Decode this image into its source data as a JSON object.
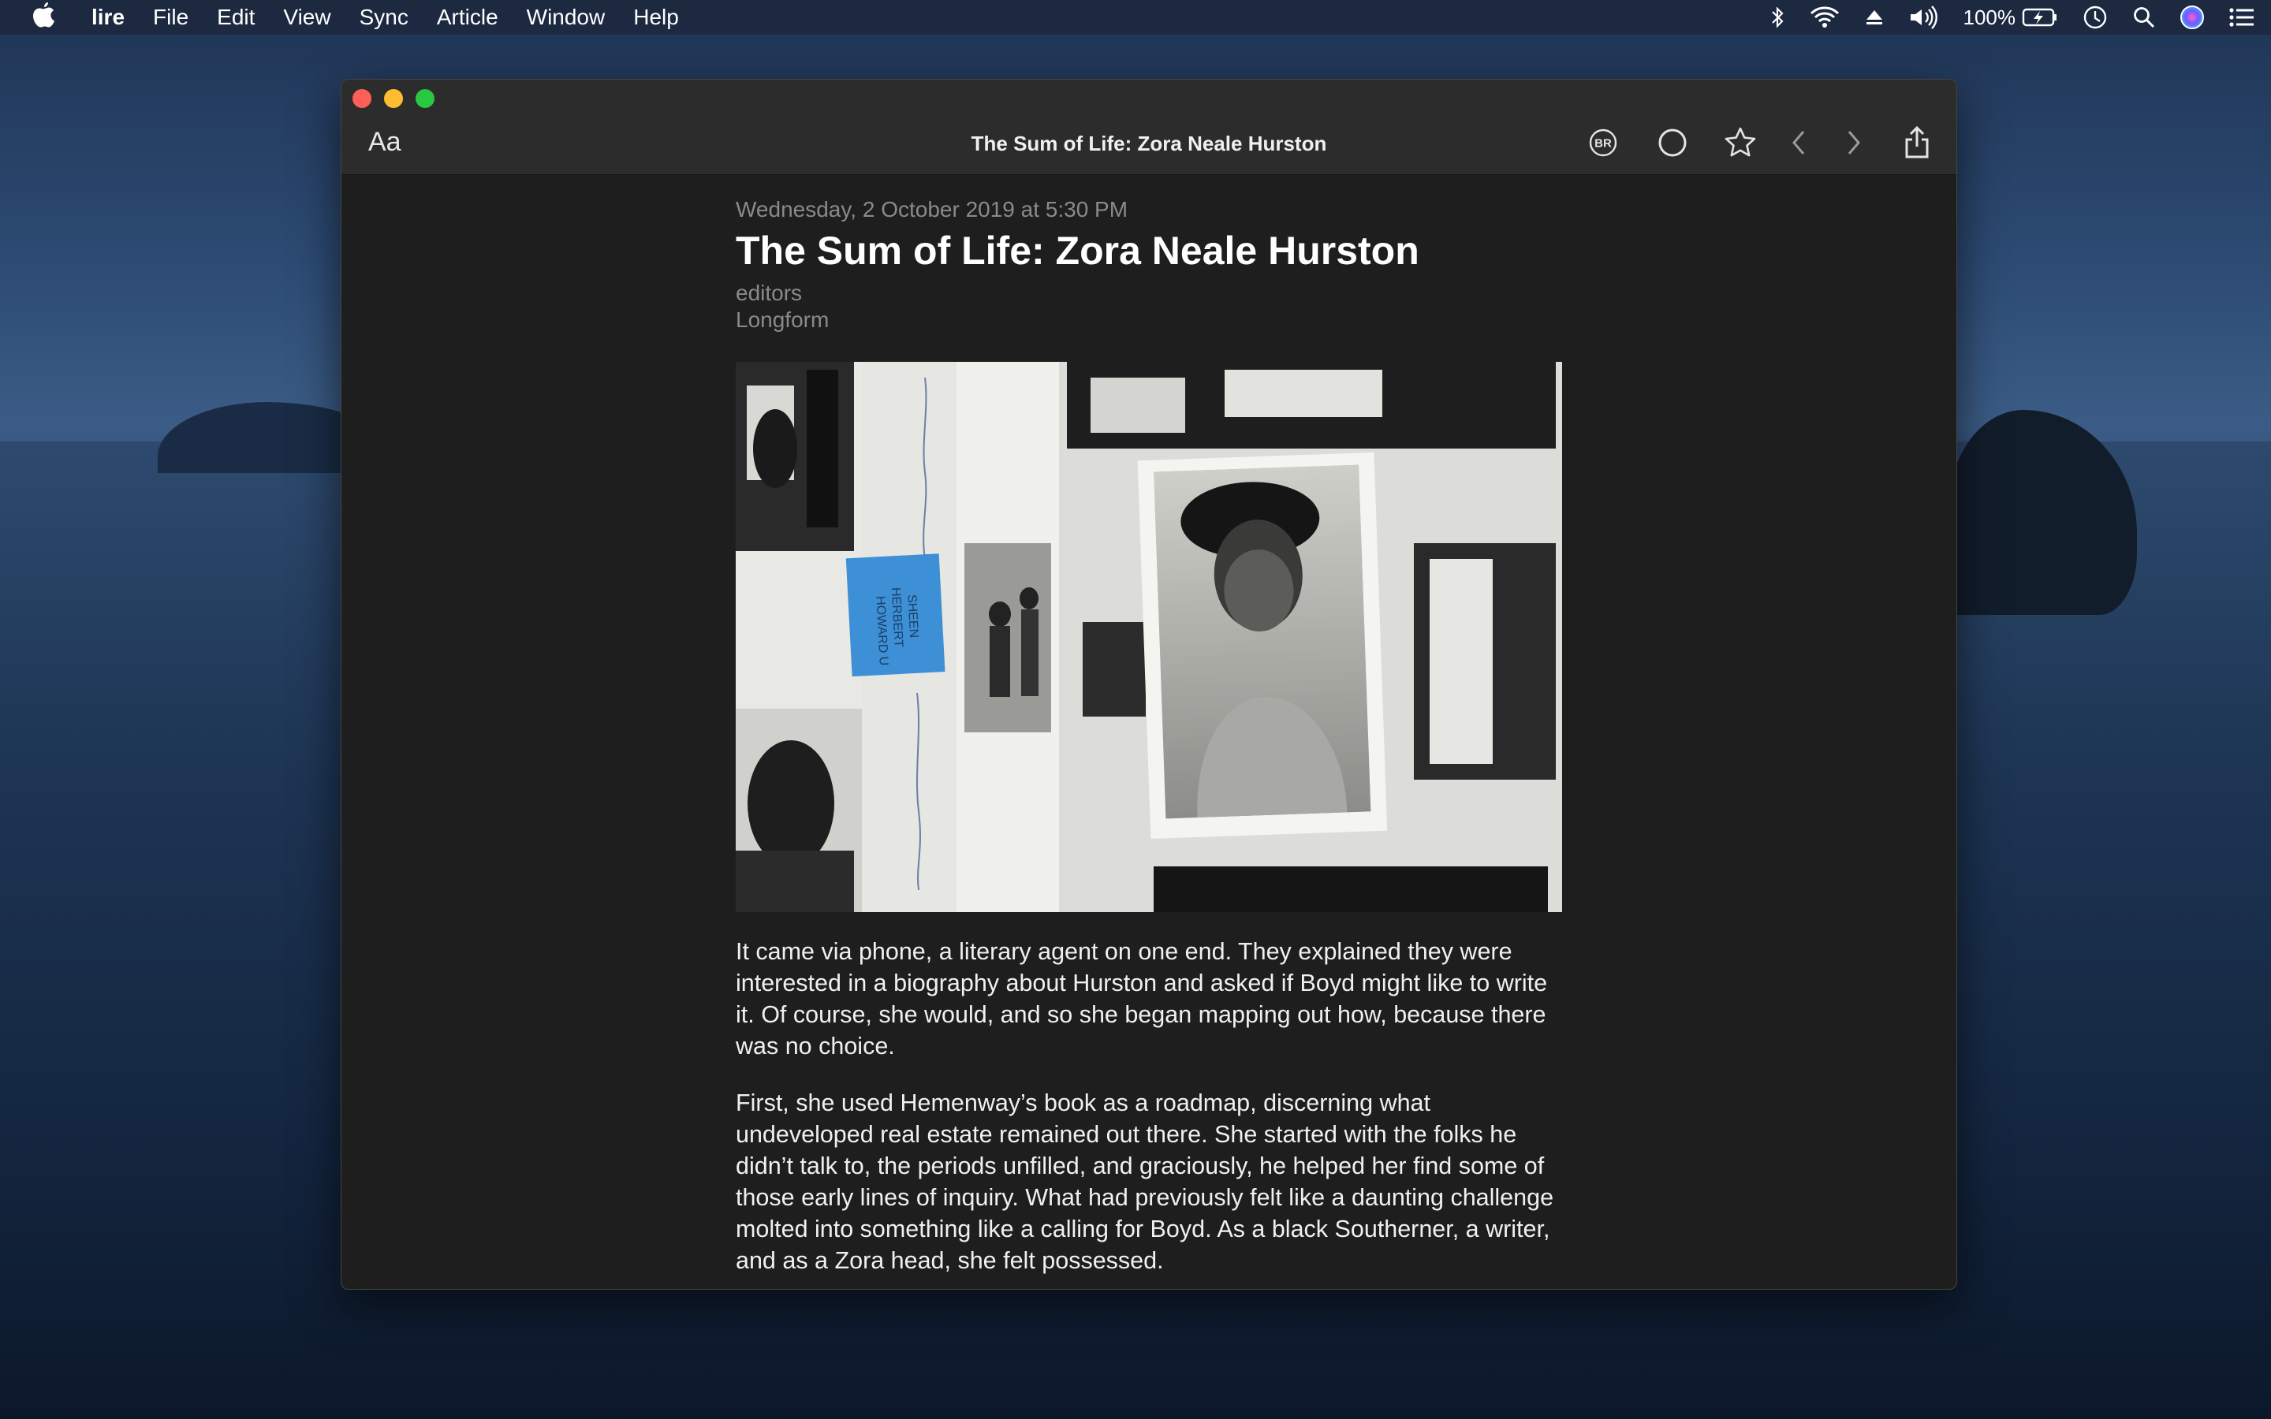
{
  "menubar": {
    "app_name": "lire",
    "menus": [
      "File",
      "Edit",
      "View",
      "Sync",
      "Article",
      "Window",
      "Help"
    ],
    "battery_percent": "100%"
  },
  "window": {
    "title": "The Sum of Life: Zora Neale Hurston",
    "font_button": "Aa",
    "br_badge": "BR"
  },
  "article": {
    "date": "Wednesday, 2 October 2019 at 5:30 PM",
    "title": "The Sum of Life: Zora Neale Hurston",
    "author": "editors",
    "feed": "Longform",
    "paragraphs": [
      "It came via phone, a literary agent on one end. They explained they were interested in a biography about Hurston and asked if Boyd might like to write it. Of course, she would, and so she began mapping out how, because there was no choice.",
      "First, she used Hemenway’s book as a roadmap, discerning what undeveloped real estate remained out there. She started with the folks he didn’t talk to, the periods unfilled, and graciously, he helped her find some of those early lines of inquiry. What had previously felt like a daunting challenge molted into something like a calling for Boyd. As a black Southerner, a writer, and as a Zora head, she felt possessed."
    ],
    "hero_sticky_note": [
      "HOWARD U",
      "HERBERT",
      "SHEEN"
    ]
  }
}
